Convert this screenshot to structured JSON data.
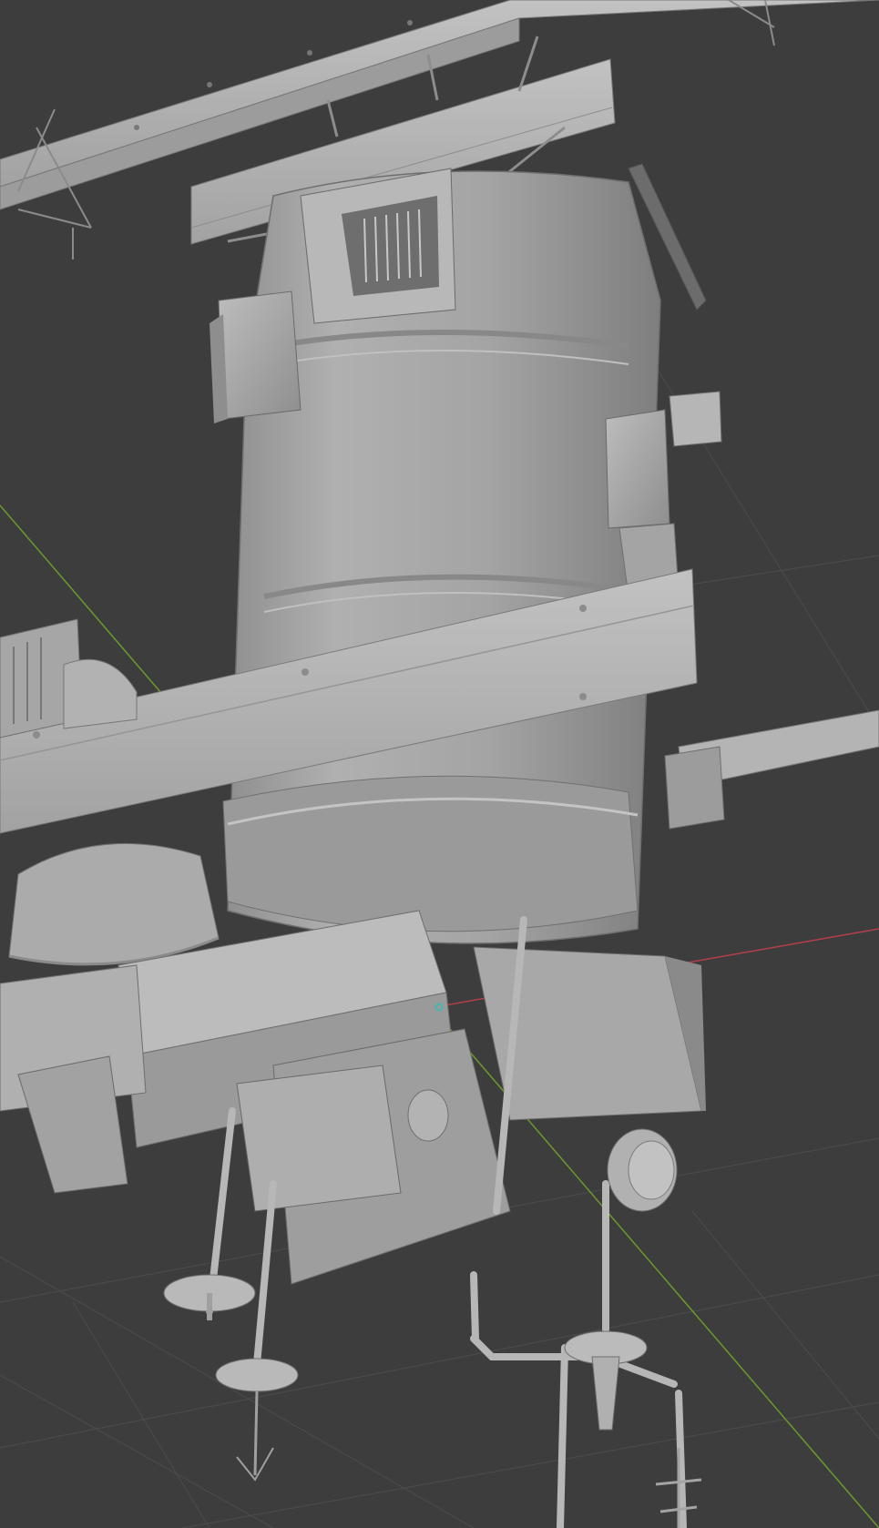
{
  "viewport": {
    "mode": "solid-shading",
    "background_color": "#3d3d3d",
    "grid_color": "#4a4a4a",
    "x_axis_color": "#b4404a",
    "y_axis_color": "#6b9a2a",
    "model_color": "#a9a9a9",
    "model_shadow_color": "#8a8a8a",
    "model_highlight_color": "#c4c4c4",
    "edge_color": "#5a5a5a",
    "origin_marker_color": "#3fb6b6"
  },
  "scene": {
    "object": "space-station-module"
  }
}
